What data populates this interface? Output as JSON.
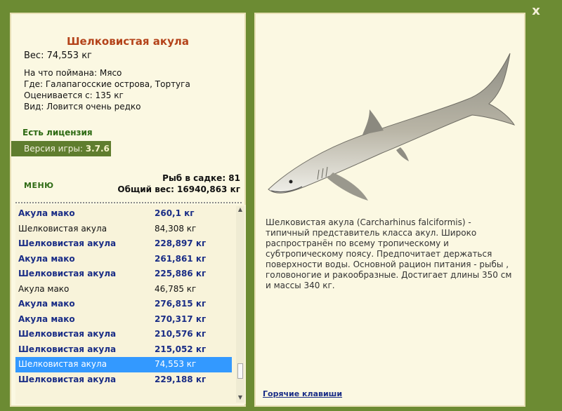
{
  "close_label": "x",
  "fish": {
    "title": "Шелковистая акула",
    "weight": "Вес: 74,553 кг",
    "caught_on": "На что поймана: Мясо",
    "location": "Где: Галапагосские острова, Тортуга",
    "valued_from": "Оценивается с: 135 кг",
    "kind": "Вид: Ловится очень редко"
  },
  "license": "Есть лицензия",
  "version": {
    "label": "Версия игры: ",
    "value": "3.7.6"
  },
  "menu_label": "МЕНЮ",
  "stats": {
    "fish_in_cage": "Рыб в садке: 81",
    "total_weight": "Общий вес: 16940,863 кг"
  },
  "catch_list": [
    {
      "name": "Акула мако",
      "weight": "260,1 кг",
      "style": "big"
    },
    {
      "name": "Шелковистая акула",
      "weight": "84,308 кг",
      "style": "small"
    },
    {
      "name": "Шелковистая акула",
      "weight": "228,897 кг",
      "style": "big"
    },
    {
      "name": "Акула мако",
      "weight": "261,861 кг",
      "style": "big"
    },
    {
      "name": "Шелковистая акула",
      "weight": "225,886 кг",
      "style": "big"
    },
    {
      "name": "Акула мако",
      "weight": "46,785 кг",
      "style": "small"
    },
    {
      "name": "Акула мако",
      "weight": "276,815 кг",
      "style": "big"
    },
    {
      "name": "Акула мако",
      "weight": "270,317 кг",
      "style": "big"
    },
    {
      "name": "Шелковистая акула",
      "weight": "210,576 кг",
      "style": "big"
    },
    {
      "name": "Шелковистая акула",
      "weight": "215,052 кг",
      "style": "big"
    },
    {
      "name": "Шелковистая акула",
      "weight": "74,553 кг",
      "style": "sel"
    },
    {
      "name": "Шелковистая акула",
      "weight": "229,188 кг",
      "style": "big"
    }
  ],
  "description": "Шелковистая акула (Carcharhinus falciformis) - типичный представитель класса акул. Широко распространён по всему тропическому и субтропическому поясу. Предпочитает держаться поверхности воды. Основной рацион питания - рыбы , головоногие и ракообразные. Достигает длины 350 см и массы 340 кг.",
  "hotkeys_label": "Горячие клавиши",
  "colors": {
    "frame": "#6c8b33",
    "panel": "#fbf8e2",
    "title": "#b4431a",
    "list_bold": "#1a2d86",
    "selection": "#3399ff",
    "license": "#2d6a13"
  }
}
